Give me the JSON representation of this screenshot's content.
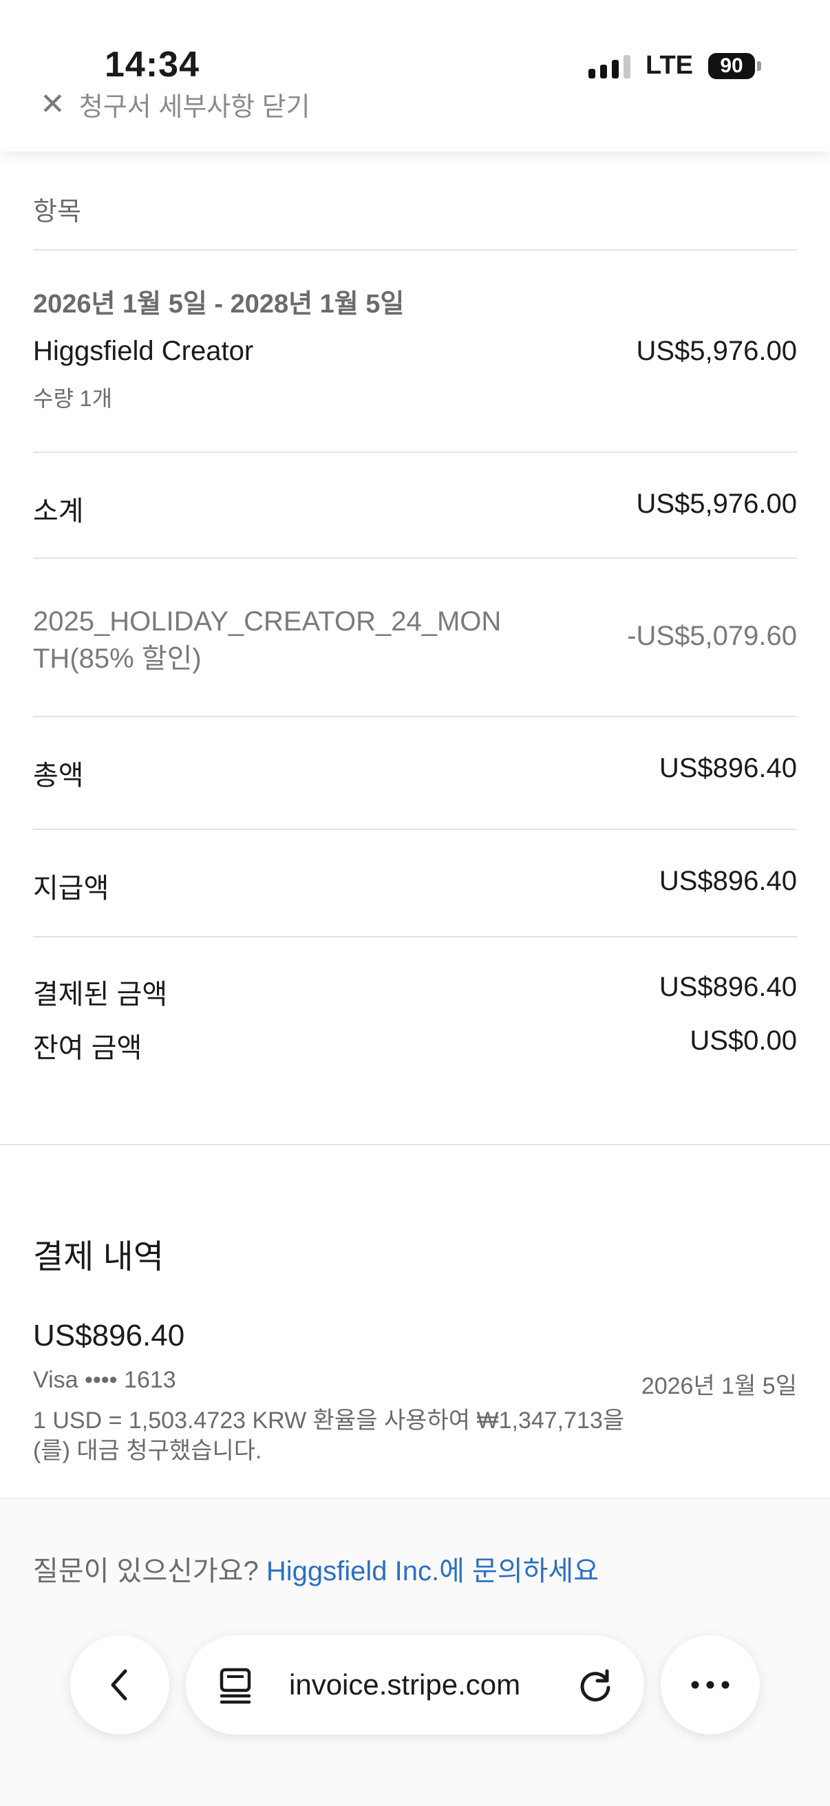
{
  "status_bar": {
    "time": "14:34",
    "network": "LTE",
    "battery": "90"
  },
  "header": {
    "close_label": "청구서 세부사항 닫기",
    "close_icon": "close-icon"
  },
  "items": {
    "section_label": "항목",
    "period": "2026년 1월 5일 - 2028년 1월 5일",
    "product_name": "Higgsfield Creator",
    "product_amount": "US$5,976.00",
    "quantity": "수량 1개"
  },
  "summary": {
    "subtotal_label": "소계",
    "subtotal_value": "US$5,976.00",
    "discount_label_line1": "2025_HOLIDAY_CREATOR_24_MON",
    "discount_label_line2": "TH(85% 할인)",
    "discount_value": "-US$5,079.60",
    "total_label": "총액",
    "total_value": "US$896.40",
    "amount_due_label": "지급액",
    "amount_due_value": "US$896.40",
    "amount_paid_label": "결제된 금액",
    "amount_paid_value": "US$896.40",
    "remaining_label": "잔여 금액",
    "remaining_value": "US$0.00"
  },
  "payment_history": {
    "title": "결제 내역",
    "amount": "US$896.40",
    "card": "Visa •••• 1613",
    "date": "2026년 1월 5일",
    "note_line1": "1 USD = 1,503.4723 KRW 환율을 사용하여 ₩1,347,713을",
    "note_line2": "(를) 대금 청구했습니다."
  },
  "footer": {
    "question_prefix": "질문이 있으신가요?",
    "contact_link": "Higgsfield Inc.에 문의하세요"
  },
  "browser_bar": {
    "url": "invoice.stripe.com",
    "back_icon": "chevron-left-icon",
    "reader_icon": "reader-mode-icon",
    "reload_icon": "reload-icon",
    "more_icon": "more-icon"
  }
}
